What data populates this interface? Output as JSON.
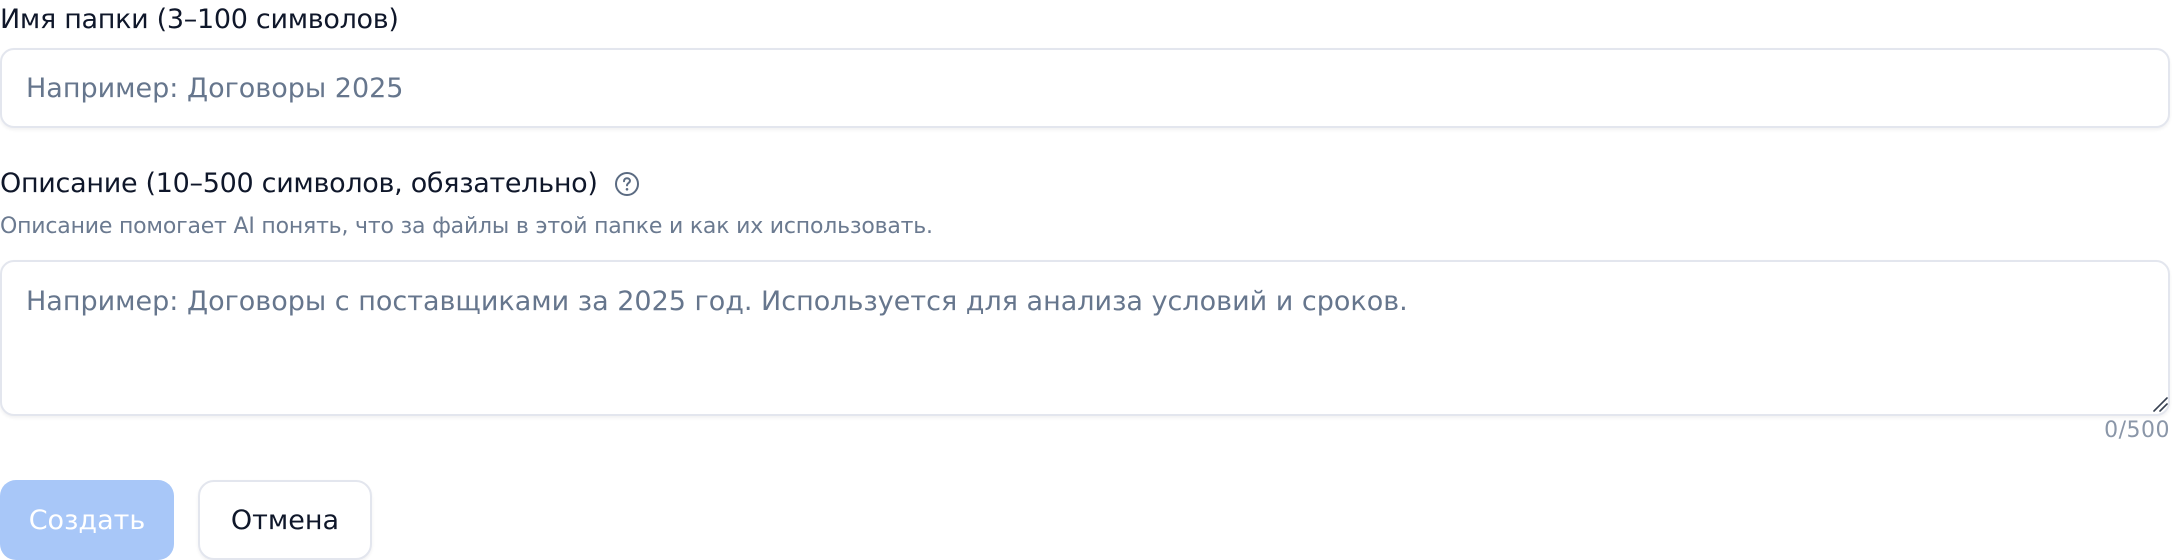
{
  "form": {
    "name_label": "Имя папки (3–100 символов)",
    "name_placeholder": "Например: Договоры 2025",
    "name_value": "",
    "description_label": "Описание (10–500 символов, обязательно)",
    "description_hint": "Описание помогает AI понять, что за файлы в этой папке и как их использовать.",
    "description_placeholder": "Например: Договоры с поставщиками за 2025 год. Используется для анализа условий и сроков.",
    "description_value": "",
    "char_counter": "0/500",
    "help_icon": "question-circle-icon"
  },
  "buttons": {
    "create_label": "Создать",
    "cancel_label": "Отмена",
    "create_disabled": true
  },
  "colors": {
    "primary_disabled": "#a8c7f8",
    "border": "#e3e6ee",
    "placeholder": "#66768d",
    "hint": "#6b7a90"
  }
}
